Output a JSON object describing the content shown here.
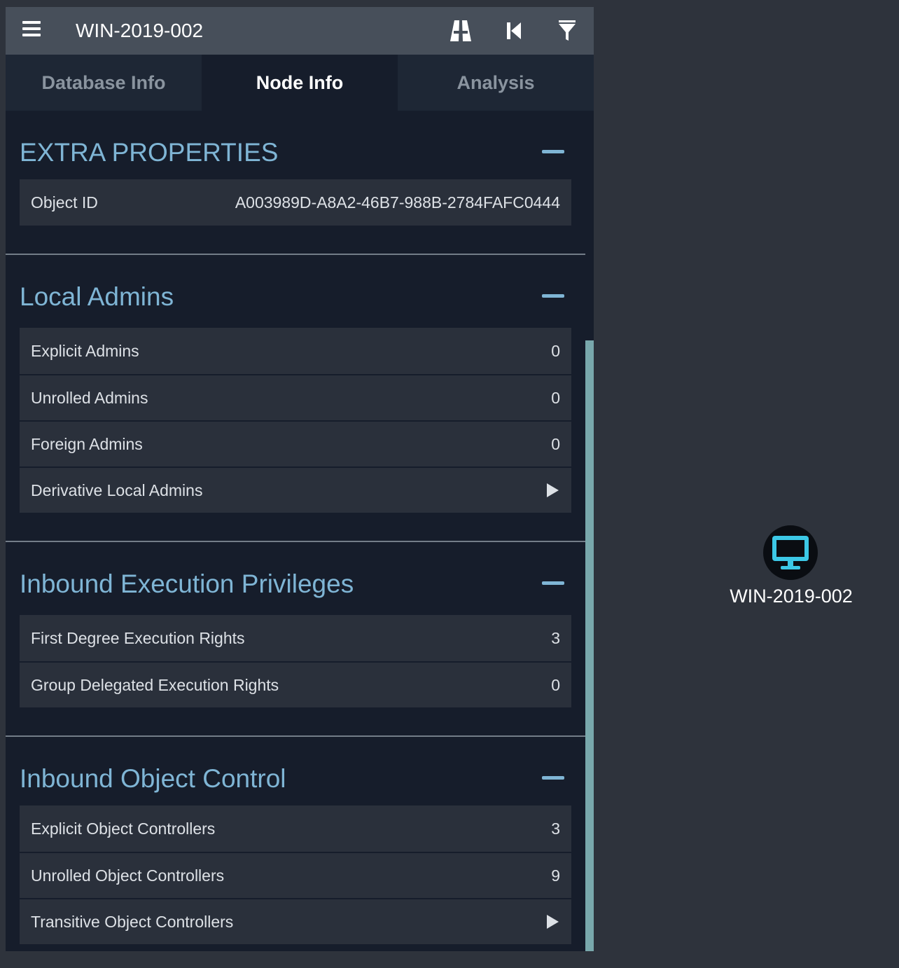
{
  "header": {
    "search_value": "WIN-2019-002",
    "menu_icon": "hamburger-menu-icon",
    "tools": [
      {
        "icon": "pathfinding-road-icon"
      },
      {
        "icon": "back-skip-icon"
      },
      {
        "icon": "filter-icon"
      }
    ]
  },
  "tabs": [
    {
      "label": "Database Info",
      "active": false
    },
    {
      "label": "Node Info",
      "active": true
    },
    {
      "label": "Analysis",
      "active": false
    }
  ],
  "sections": {
    "extra": {
      "title": "EXTRA PROPERTIES",
      "rows": [
        {
          "label": "Object ID",
          "value": "A003989D-A8A2-46B7-988B-2784FAFC0444"
        }
      ]
    },
    "local_admins": {
      "title": "Local Admins",
      "rows": [
        {
          "label": "Explicit Admins",
          "value": "0"
        },
        {
          "label": "Unrolled Admins",
          "value": "0"
        },
        {
          "label": "Foreign Admins",
          "value": "0"
        },
        {
          "label": "Derivative Local Admins",
          "value": null
        }
      ]
    },
    "execution": {
      "title": "Inbound Execution Privileges",
      "rows": [
        {
          "label": "First Degree Execution Rights",
          "value": "3"
        },
        {
          "label": "Group Delegated Execution Rights",
          "value": "0"
        }
      ]
    },
    "object_control": {
      "title": "Inbound Object Control",
      "rows": [
        {
          "label": "Explicit Object Controllers",
          "value": "3"
        },
        {
          "label": "Unrolled Object Controllers",
          "value": "9"
        },
        {
          "label": "Transitive Object Controllers",
          "value": null
        }
      ]
    }
  },
  "graph": {
    "node_label": "WIN-2019-002",
    "node_icon": "computer-monitor-icon"
  },
  "colors": {
    "accent": "#7fb5d5",
    "node_icon": "#3cc8e6",
    "panel_bg": "#161d2b",
    "canvas_bg": "#2e333c"
  }
}
